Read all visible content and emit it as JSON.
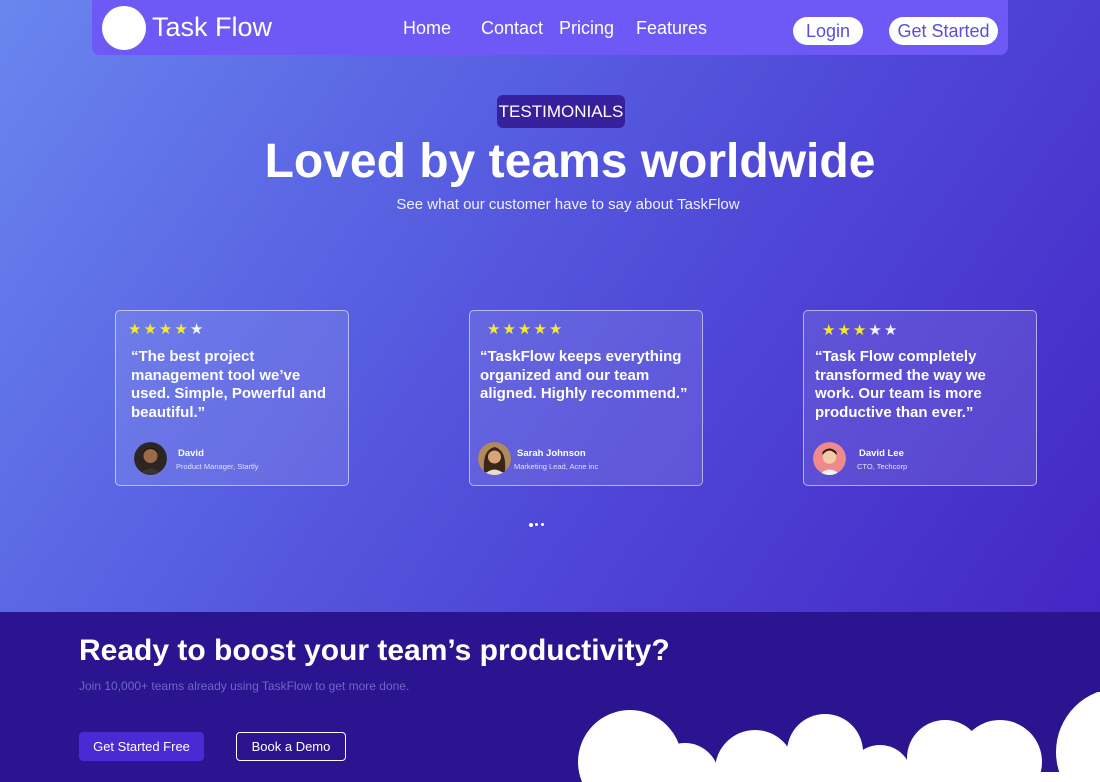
{
  "nav": {
    "brand": "Task Flow",
    "links": [
      "Home",
      "Contact",
      "Pricing",
      "Features"
    ],
    "login_label": "Login",
    "get_started_label": "Get Started"
  },
  "testimonials": {
    "badge": "TESTIMONIALS",
    "title": "Loved by teams worldwide",
    "subtitle": "See what our customer have to say about TaskFlow",
    "cards": [
      {
        "rating": 4,
        "quote": "“The best project management tool we’ve used. Simple, Powerful and beautiful.”",
        "name": "David",
        "role": "Product Manager, Startly"
      },
      {
        "rating": 5,
        "quote": "“TaskFlow keeps everything organized and our team aligned. Highly recommend.”",
        "name": "Sarah Johnson",
        "role": "Marketing Lead, Acne inc"
      },
      {
        "rating": 3,
        "quote": "“Task Flow completely transformed the way we work. Our team is more productive than ever.”",
        "name": "David Lee",
        "role": "CTO, Techcorp"
      }
    ],
    "carousel_dots": 3
  },
  "cta": {
    "title": "Ready to boost your team’s productivity?",
    "subtitle": "Join 10,000+ teams already using TaskFlow to get more done.",
    "primary_label": "Get Started Free",
    "secondary_label": "Book a Demo"
  },
  "icons": {
    "star": "star-icon",
    "logo": "logo-icon",
    "cloud": "cloud-decoration"
  },
  "colors": {
    "nav_bg": "#6e58f6",
    "badge_bg": "#36209c",
    "star_filled": "#f3ea2a",
    "cta_bg": "#2a1490",
    "primary_button": "#4a2ad2"
  }
}
